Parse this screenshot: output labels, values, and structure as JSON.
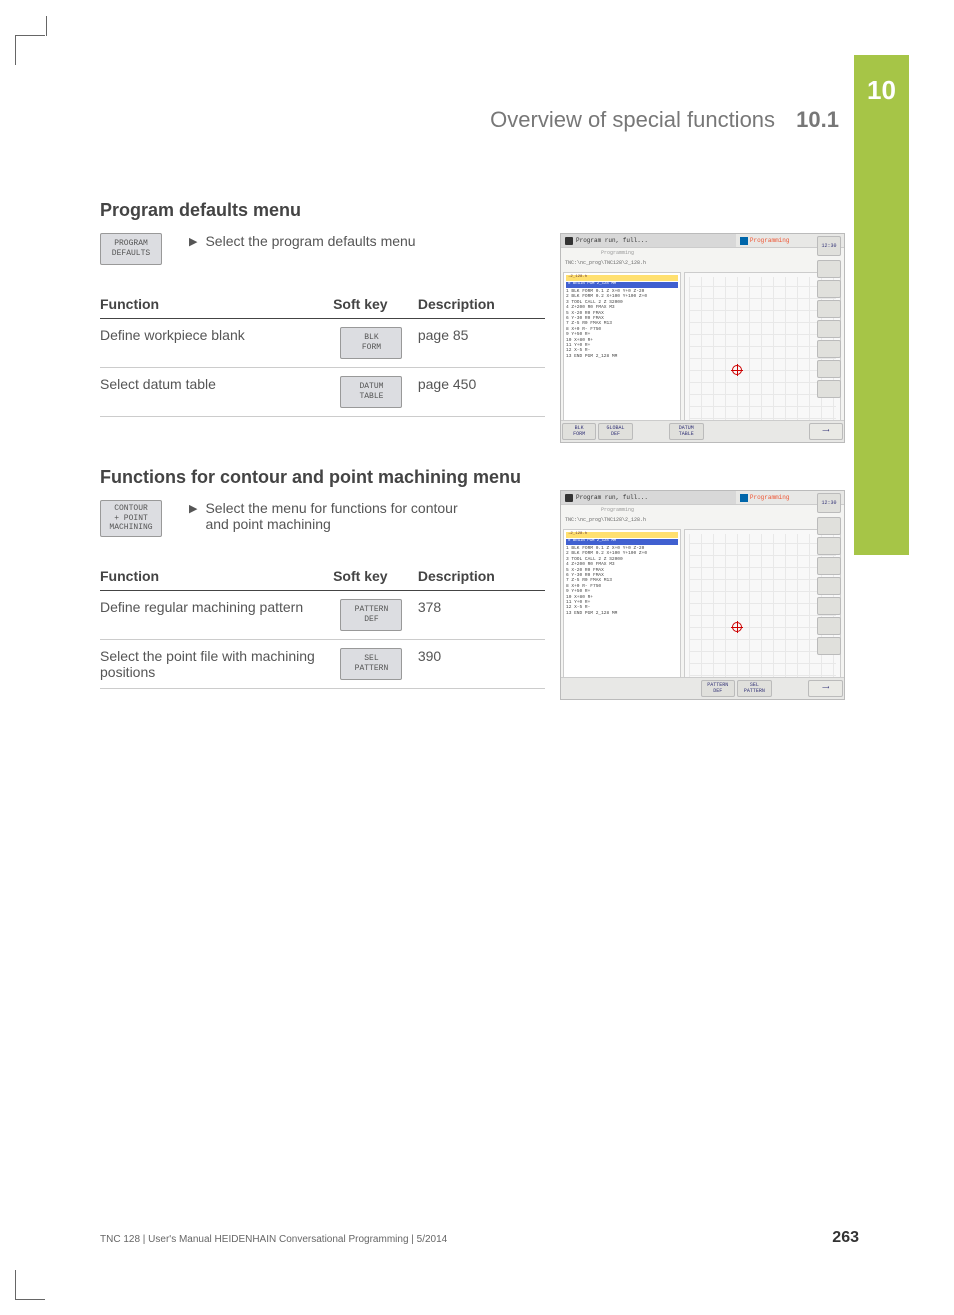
{
  "sideTab": {
    "chapter": "10"
  },
  "header": {
    "title": "Overview of special functions",
    "section": "10.1"
  },
  "sections": [
    {
      "heading": "Program defaults menu",
      "softkey": "PROGRAM\nDEFAULTS",
      "instruction": "Select the program defaults menu",
      "tableHeaders": {
        "func": "Function",
        "softkey": "Soft key",
        "desc": "Description"
      },
      "rows": [
        {
          "func": "Define workpiece blank",
          "softkey": "BLK\nFORM",
          "desc": "page 85"
        },
        {
          "func": "Select datum table",
          "softkey": "DATUM\nTABLE",
          "desc": "page 450"
        }
      ],
      "screenshot": {
        "titleLeft": "Program run, full...",
        "titleRight": "Programming",
        "subtitle": "Programming",
        "topRightBtn": "12:30",
        "path": "TNC:\\nc_prog\\TNC128\\2_128.h",
        "yellowBar": "→2_128.h",
        "blueBar": "0 BEGIN PGM 2_128 MM",
        "codeLines": [
          "1  BLK FORM 0.1 Z X+0 Y+0 Z-20",
          "2  BLK FORM 0.2  X+100  Y+100  Z+0",
          "3  TOOL CALL 2 Z S2000",
          "4    Z+200 R0 FMAX M3",
          "5    X-20 R0 FMAX",
          "6    Y-30 R0 FMAX",
          "7    Z-5 R0 FMAX M13",
          "8    X+0 R- F750",
          "9    Y+50 R+",
          "10   X+80 R+",
          "11   Y+0 R+",
          "12   X-5 R-",
          "13 END PGM 2_128 MM"
        ],
        "bottomButtons": [
          "BLK\nFORM",
          "GLOBAL\nDEF",
          "",
          "DATUM\nTABLE",
          "",
          "",
          ""
        ]
      }
    },
    {
      "heading": "Functions for contour and point machining menu",
      "softkey": "CONTOUR\n+ POINT\nMACHINING",
      "instruction": "Select the menu for functions for contour and point machining",
      "tableHeaders": {
        "func": "Function",
        "softkey": "Soft key",
        "desc": "Description"
      },
      "rows": [
        {
          "func": "Define regular machining pattern",
          "softkey": "PATTERN\nDEF",
          "desc": "378"
        },
        {
          "func": "Select the point file with machining positions",
          "softkey": "SEL\nPATTERN",
          "desc": "390"
        }
      ],
      "screenshot": {
        "titleLeft": "Program run, full...",
        "titleRight": "Programming",
        "subtitle": "Programming",
        "topRightBtn": "12:30",
        "path": "TNC:\\nc_prog\\TNC128\\2_128.h",
        "yellowBar": "→2_128.h",
        "blueBar": "0 BEGIN PGM 2_128 MM",
        "codeLines": [
          "1  BLK FORM 0.1 Z X+0 Y+0 Z-20",
          "2  BLK FORM 0.2  X+100  Y+100  Z+0",
          "3  TOOL CALL 2 Z S2000",
          "4    Z+200 R0 FMAX M3",
          "5    X-20 R0 FMAX",
          "6    Y-30 R0 FMAX",
          "7    Z-5 R0 FMAX M13",
          "8    X+0 R- F750",
          "9    Y+50 R+",
          "10   X+80 R+",
          "11   Y+0 R+",
          "12   X-5 R-",
          "13 END PGM 2_128 MM"
        ],
        "bottomButtons": [
          "",
          "",
          "",
          "",
          "PATTERN\nDEF",
          "SEL\nPATTERN",
          ""
        ]
      }
    }
  ],
  "footer": {
    "text": "TNC 128 | User's Manual HEIDENHAIN Conversational Programming | 5/2014",
    "page": "263"
  }
}
